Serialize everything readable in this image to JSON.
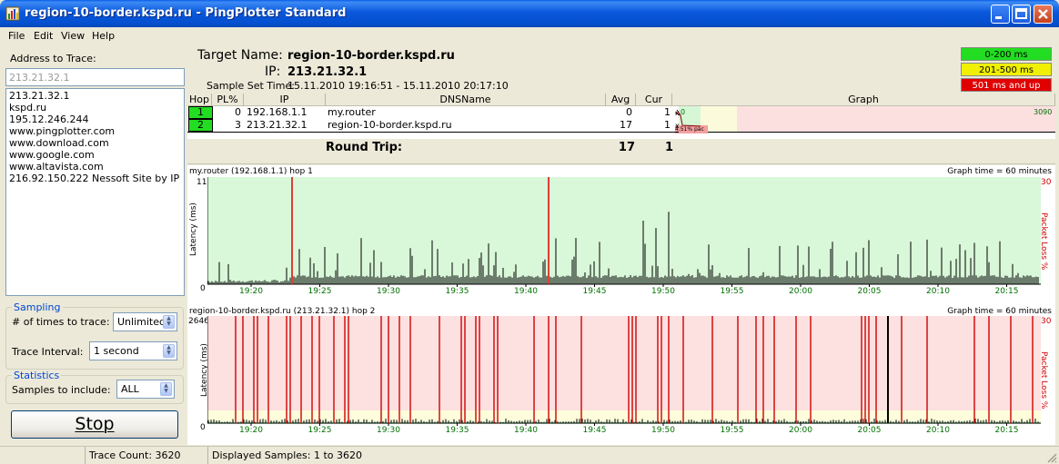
{
  "window": {
    "title": "region-10-border.kspd.ru - PingPlotter Standard"
  },
  "menu": [
    "File",
    "Edit",
    "View",
    "Help"
  ],
  "left": {
    "address_label": "Address to Trace:",
    "address_value": "213.21.32.1",
    "history": [
      "213.21.32.1",
      "kspd.ru",
      "195.12.246.244",
      "www.pingplotter.com",
      "www.download.com",
      "www.google.com",
      "www.altavista.com",
      "216.92.150.222 Nessoft Site by IP"
    ],
    "sampling": {
      "title": "Sampling",
      "times_label": "# of times to trace:",
      "times_value": "Unlimited",
      "interval_label": "Trace Interval:",
      "interval_value": "1 second"
    },
    "statistics": {
      "title": "Statistics",
      "samples_label": "Samples to include:",
      "samples_value": "ALL"
    },
    "stop_label": "Stop"
  },
  "target": {
    "name_label": "Target Name:",
    "name_value": "region-10-border.kspd.ru",
    "ip_label": "IP:",
    "ip_value": "213.21.32.1",
    "sample_label": "Sample Set Time:",
    "sample_value": "15.11.2010 19:16:51 - 15.11.2010 20:17:10"
  },
  "legend": [
    {
      "label": "0-200 ms",
      "color": "#22dd22",
      "text_color": "#000000"
    },
    {
      "label": "201-500 ms",
      "color": "#f0f000",
      "text_color": "#000000"
    },
    {
      "label": "501 ms and up",
      "color": "#e00000",
      "text_color": "#ffffff"
    }
  ],
  "table": {
    "columns": [
      "Hop",
      "PL%",
      "IP",
      "DNSName",
      "Avg",
      "Cur",
      "Graph"
    ],
    "rows": [
      {
        "hop": "1",
        "pl": "0",
        "ip": "192.168.1.1",
        "dns": "my.router",
        "avg": "0",
        "cur": "1"
      },
      {
        "hop": "2",
        "pl": "3",
        "ip": "213.21.32.1",
        "dns": "region-10-border.kspd.ru",
        "avg": "17",
        "cur": "1"
      }
    ],
    "graph_scale_label": "3090",
    "graph_zero_label": "0",
    "graph_loss_label": "4.51% pac",
    "round_trip": {
      "label": "Round Trip:",
      "avg": "17",
      "cur": "1"
    }
  },
  "graphs": [
    {
      "title": "my.router (192.168.1.1) hop 1",
      "time_label": "Graph time = 60 minutes",
      "ymax": "11",
      "ymin": "0",
      "loss_max": "30",
      "ylabel": "Latency (ms)",
      "y2label": "Packet Loss %",
      "ticks": [
        "19:20",
        "19:25",
        "19:30",
        "19:35",
        "19:40",
        "19:45",
        "19:50",
        "19:55",
        "20:00",
        "20:05",
        "20:10",
        "20:15"
      ]
    },
    {
      "title": "region-10-border.kspd.ru (213.21.32.1) hop 2",
      "time_label": "Graph time = 60 minutes",
      "ymax": "2646",
      "ymin": "0",
      "loss_max": "30",
      "ylabel": "Latency (ms)",
      "y2label": "Packet Loss %",
      "ticks": [
        "19:20",
        "19:25",
        "19:30",
        "19:35",
        "19:40",
        "19:45",
        "19:50",
        "19:55",
        "20:00",
        "20:05",
        "20:10",
        "20:15"
      ]
    }
  ],
  "status": {
    "trace_count": "Trace Count: 3620",
    "displayed": "Displayed Samples: 1 to 3620"
  }
}
